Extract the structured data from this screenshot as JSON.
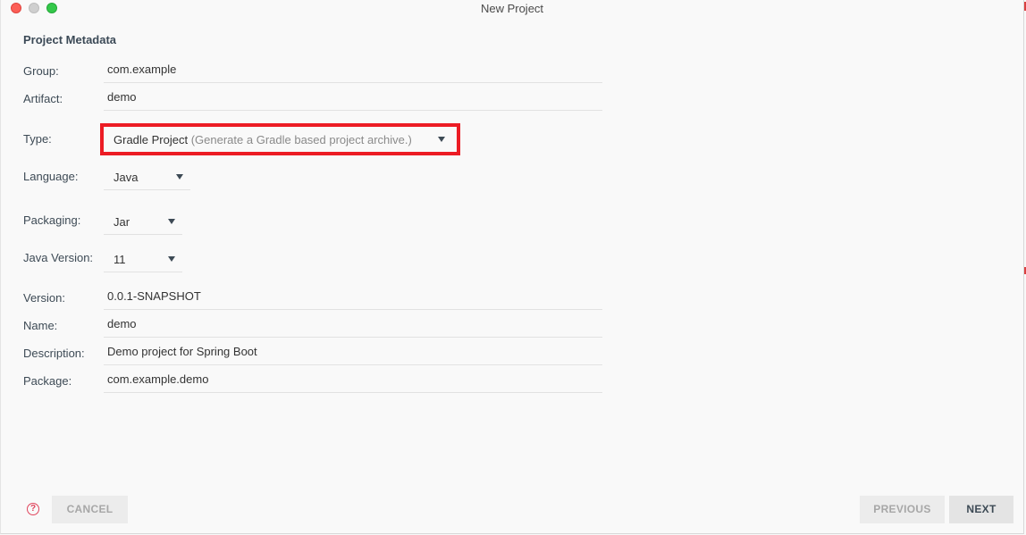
{
  "window": {
    "title": "New Project"
  },
  "section_title": "Project Metadata",
  "fields": {
    "group": {
      "label": "Group:",
      "value": "com.example"
    },
    "artifact": {
      "label": "Artifact:",
      "value": "demo"
    },
    "type": {
      "label": "Type:",
      "value": "Gradle Project",
      "hint": "(Generate a Gradle based project archive.)"
    },
    "language": {
      "label": "Language:",
      "value": "Java"
    },
    "packaging": {
      "label": "Packaging:",
      "value": "Jar"
    },
    "java_version": {
      "label": "Java Version:",
      "value": "11"
    },
    "version": {
      "label": "Version:",
      "value": "0.0.1-SNAPSHOT"
    },
    "name": {
      "label": "Name:",
      "value": "demo"
    },
    "description": {
      "label": "Description:",
      "value": "Demo project for Spring Boot"
    },
    "package": {
      "label": "Package:",
      "value": "com.example.demo"
    }
  },
  "footer": {
    "help_icon": "?",
    "cancel_label": "CANCEL",
    "previous_label": "PREVIOUS",
    "next_label": "NEXT"
  },
  "icons": {
    "dropdown": "chevron-down-icon",
    "help": "question-circle-icon"
  },
  "colors": {
    "highlight": "#ec1c24",
    "help_icon": "#e0445c"
  }
}
